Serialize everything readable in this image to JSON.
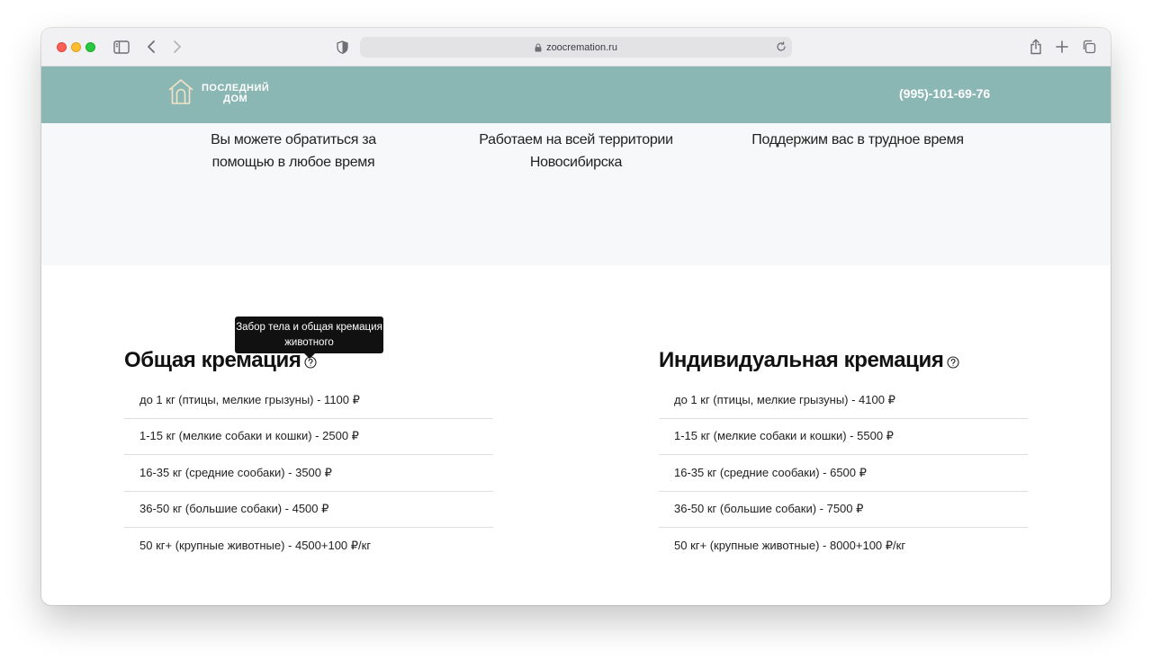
{
  "browser": {
    "url": "zoocremation.ru"
  },
  "header": {
    "logo_line1": "ПОСЛЕДНИЙ",
    "logo_line2": "ДОМ",
    "phone": "(995)-101-69-76"
  },
  "features": [
    {
      "text": "Вы можете обратиться за помощью в любое время"
    },
    {
      "text": "Работаем на всей территории Новосибирска"
    },
    {
      "text": "Поддержим вас в трудное время"
    }
  ],
  "tooltip": {
    "text": "Забор тела и общая кремация животного"
  },
  "pricing": {
    "general": {
      "title": "Общая кремация",
      "items": [
        "до 1 кг (птицы, мелкие грызуны) - 1100 ₽",
        "1-15 кг (мелкие собаки и кошки) - 2500 ₽",
        "16-35 кг (средние сообаки) - 3500 ₽",
        "36-50 кг (большие собаки) - 4500 ₽",
        "50 кг+ (крупные животные) - 4500+100 ₽/кг"
      ]
    },
    "individual": {
      "title": "Индивидуальная кремация",
      "items": [
        "до 1 кг (птицы, мелкие грызуны) - 4100 ₽",
        "1-15 кг (мелкие собаки и кошки) - 5500 ₽",
        "16-35 кг (средние сообаки) - 6500 ₽",
        "36-50 кг (большие собаки) - 7500 ₽",
        "50 кг+ (крупные животные) - 8000+100 ₽/кг"
      ]
    }
  }
}
